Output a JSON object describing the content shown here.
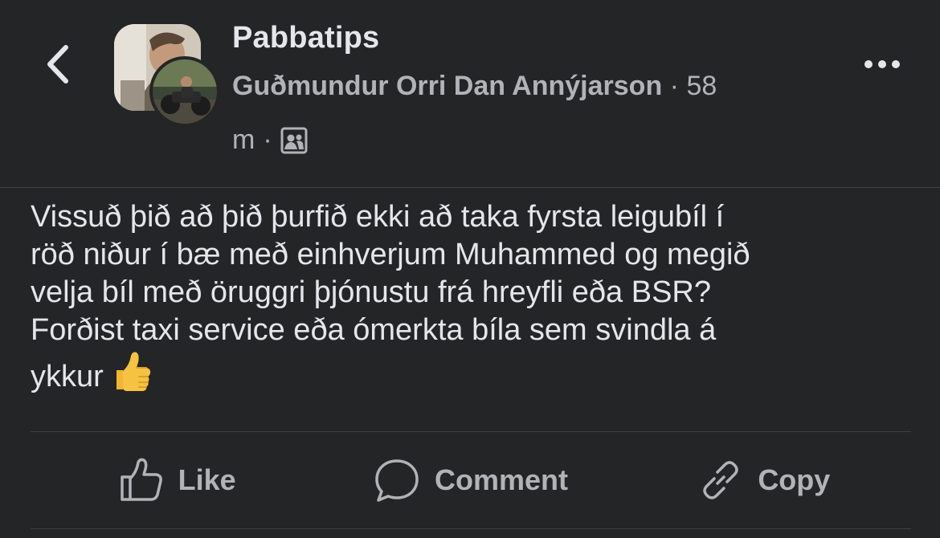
{
  "header": {
    "group_name": "Pabbatips",
    "author": "Guðmundur Orri Dan Annýjarson",
    "separator": " · ",
    "time_part1": "58",
    "time_part2": "m",
    "icons": {
      "back": "chevron-left-icon",
      "privacy": "members-icon",
      "more": "more-horizontal-icon"
    }
  },
  "post": {
    "lines": [
      "Vissuð þið að þið þurfið ekki að taka fyrsta leigubíl í",
      "röð niður í bæ með einhverjum Muhammed og megið",
      "velja bíl með öruggri þjónustu frá hreyfli eða BSR?",
      "Forðist taxi service eða ómerkta bíla sem svindla á",
      "ykkur"
    ],
    "emoji": "thumbs-up-emoji"
  },
  "actions": [
    {
      "label": "Like",
      "icon": "thumbs-up-icon"
    },
    {
      "label": "Comment",
      "icon": "comment-bubble-icon"
    },
    {
      "label": "Copy",
      "icon": "link-icon"
    }
  ],
  "colors": {
    "background": "#242526",
    "primary_text": "#e4e6eb",
    "secondary_text": "#b0b3b8",
    "divider": "#3e4042",
    "emoji_yellow": "#f6c244"
  }
}
